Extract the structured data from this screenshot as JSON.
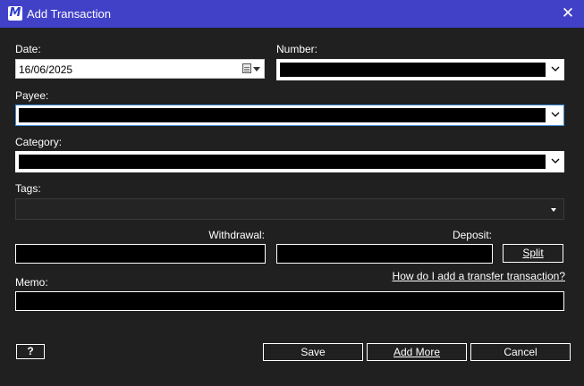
{
  "window": {
    "title": "Add Transaction",
    "app_icon_letter": "M",
    "close_glyph": "✕"
  },
  "form": {
    "date_label": "Date:",
    "date_value": "16/06/2025",
    "number_label": "Number:",
    "number_value": "",
    "payee_label": "Payee:",
    "payee_value": "",
    "category_label": "Category:",
    "category_value": "",
    "tags_label": "Tags:",
    "tags_value": "",
    "withdrawal_label": "Withdrawal:",
    "withdrawal_value": "",
    "deposit_label": "Deposit:",
    "deposit_value": "",
    "split_label": "Split",
    "transfer_help_link": "How do I add a transfer transaction?",
    "memo_label": "Memo:",
    "memo_value": ""
  },
  "buttons": {
    "help_label": "?",
    "save_label": "Save",
    "add_more_label": "Add More",
    "cancel_label": "Cancel"
  },
  "icons": {
    "date_picker": "calendar-icon",
    "dropdown": "chevron-down-icon",
    "close": "close-icon"
  },
  "colors": {
    "titlebar": "#4141c8",
    "background": "#202020",
    "focus_border": "#3d8fd8"
  }
}
